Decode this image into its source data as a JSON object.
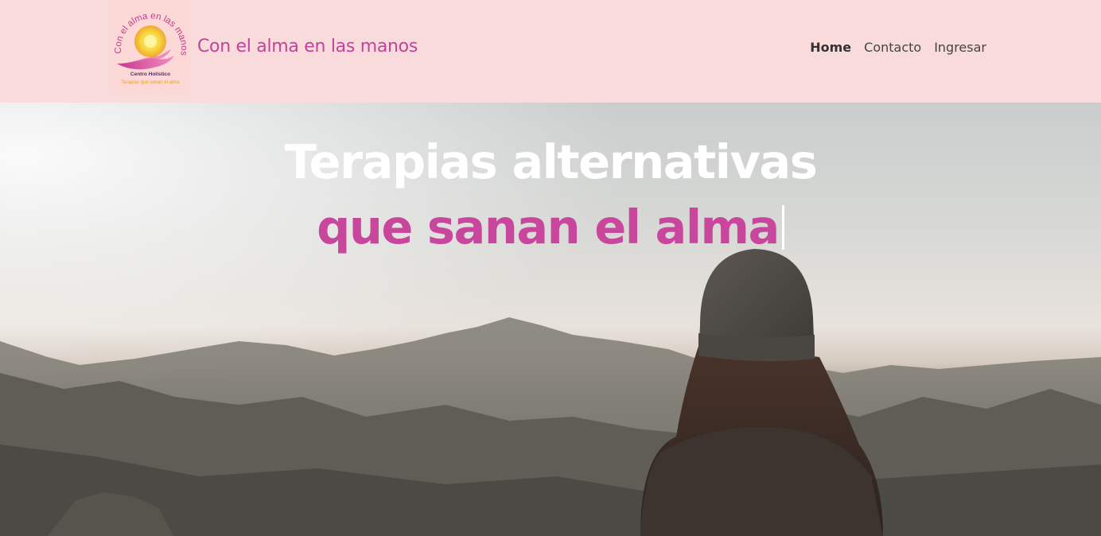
{
  "brand": {
    "logo_arc_text": "Con el alma en las manos",
    "logo_subtitle": "Centro Holístico",
    "logo_tagline": "Terapias que sanan el alma",
    "name": "Con el alma en las manos"
  },
  "nav": {
    "items": [
      {
        "label": "Home",
        "active": true
      },
      {
        "label": "Contacto",
        "active": false
      },
      {
        "label": "Ingresar",
        "active": false
      }
    ]
  },
  "hero": {
    "title_white": "Terapias alternativas ",
    "title_accent": "que sanan el alma"
  },
  "colors": {
    "navbar_bg": "#fadbdb",
    "brand_pink": "#c2439a",
    "accent_pink": "#c8469c"
  }
}
